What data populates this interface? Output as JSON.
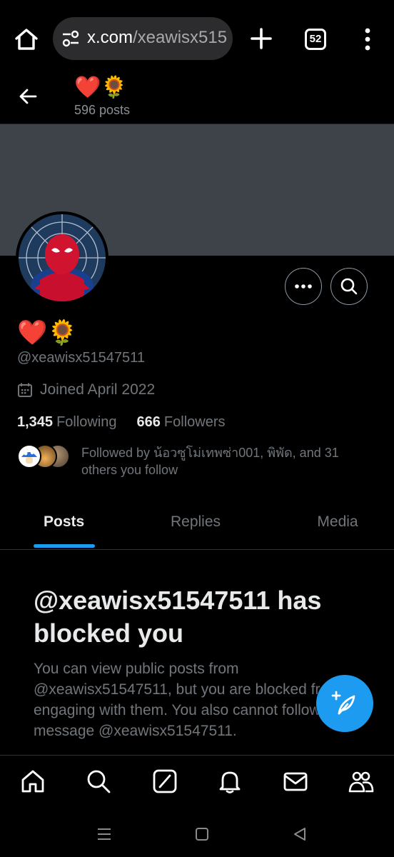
{
  "browser": {
    "url_host": "x.com",
    "url_path": "/xeawisx515",
    "tab_count": "52"
  },
  "header": {
    "title": "❤️🌻",
    "post_count": "596 posts"
  },
  "profile": {
    "display_name": "❤️🌻",
    "handle": "@xeawisx51547511",
    "joined": "Joined April 2022",
    "following_count": "1,345",
    "following_label": "Following",
    "followers_count": "666",
    "followers_label": "Followers",
    "followed_by": "Followed by น้อวซูโม่เทพซ่า001, พิพัด, and 31 others you follow"
  },
  "tabs": [
    {
      "label": "Posts",
      "active": true
    },
    {
      "label": "Replies",
      "active": false
    },
    {
      "label": "Media",
      "active": false
    }
  ],
  "blocked": {
    "title": "@xeawisx51547511 has blocked you",
    "body": "You can view public posts from @xeawisx51547511, but you are blocked from engaging with them. You also cannot follow or message @xeawisx51547511."
  },
  "colors": {
    "accent": "#1d9bf0",
    "banner": "#3d4349",
    "muted_text": "#71767b"
  },
  "icons": {
    "browser": [
      "home-icon",
      "site-settings-icon",
      "new-tab-icon",
      "tab-switcher-icon",
      "browser-menu-icon"
    ],
    "header": [
      "back-arrow-icon"
    ],
    "profile_actions": [
      "more-icon",
      "search-icon"
    ],
    "fab": "compose-post-icon",
    "bottom_nav": [
      "home-icon",
      "search-icon",
      "grok-icon",
      "notifications-icon",
      "messages-icon",
      "communities-icon"
    ],
    "system_nav": [
      "recent-apps-icon",
      "system-home-icon",
      "system-back-icon"
    ]
  }
}
